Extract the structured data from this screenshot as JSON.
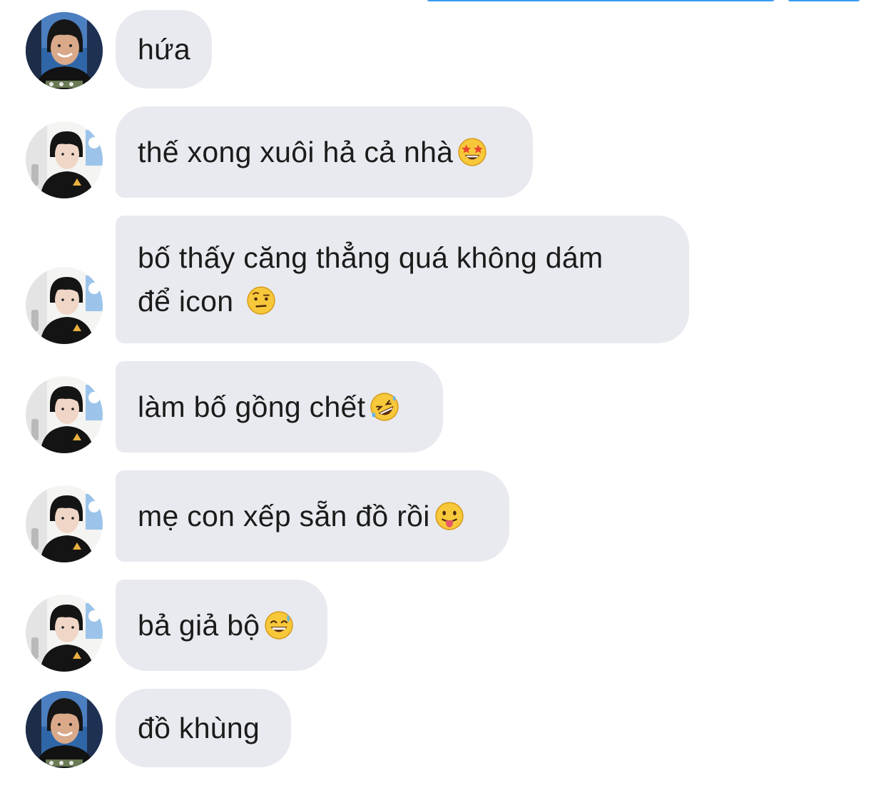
{
  "messages": [
    {
      "text": "hứa",
      "emoji": null,
      "avatar": "avatar-a"
    },
    {
      "text": "thế xong xuôi hả cả nhà",
      "emoji": "star-struck-emoji-icon",
      "avatar": "avatar-b"
    },
    {
      "text": "bố thấy căng thẳng quá không dám\nđể icon",
      "emoji": "raised-eyebrow-emoji-icon",
      "avatar": "avatar-b"
    },
    {
      "text": "làm bố gồng chết",
      "emoji": "rolling-laughing-emoji-icon",
      "avatar": "avatar-b"
    },
    {
      "text": "mẹ con xếp sẵn đồ rồi",
      "emoji": "tongue-out-emoji-icon",
      "avatar": "avatar-b"
    },
    {
      "text": "bả giả bộ",
      "emoji": "grinning-sweat-emoji-icon",
      "avatar": "avatar-b"
    },
    {
      "text": "đồ khùng",
      "emoji": null,
      "avatar": "avatar-a"
    }
  ],
  "colors": {
    "bubble_bg": "#e8eaef",
    "text": "#1b1b1b",
    "accent_bar": "#3a9bf0"
  }
}
